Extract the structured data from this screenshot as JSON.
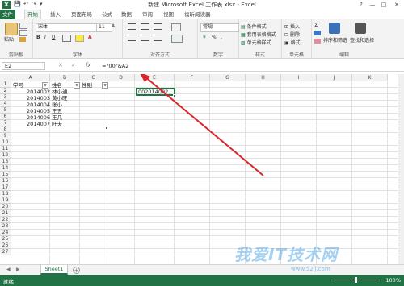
{
  "window": {
    "title": "新建 Microsoft Excel 工作表.xlsx - Excel",
    "app_letter": "X",
    "controls": [
      "?",
      "—",
      "□",
      "✕"
    ]
  },
  "quick_access": [
    "💾",
    "↶",
    "↷",
    "▾"
  ],
  "ribbon_tabs": [
    "文件",
    "开始",
    "插入",
    "页面布局",
    "公式",
    "数据",
    "审阅",
    "视图",
    "福昕阅读器"
  ],
  "ribbon": {
    "clipboard": {
      "label": "剪贴板",
      "paste": "粘贴"
    },
    "font": {
      "label": "字体",
      "name": "宋体",
      "size": "11",
      "bold": "B",
      "italic": "I",
      "underline": "U"
    },
    "alignment": {
      "label": "对齐方式"
    },
    "number": {
      "label": "数字",
      "format": "常规",
      "percent": "%",
      "comma": ","
    },
    "styles": {
      "label": "样式",
      "conditional": "条件格式",
      "table": "套用表格格式",
      "cell": "单元格样式"
    },
    "cells": {
      "label": "单元格",
      "insert": "插入",
      "delete": "删除",
      "format": "格式"
    },
    "editing": {
      "label": "编辑",
      "sort": "排序和筛选",
      "find": "查找和选择"
    }
  },
  "formula_bar": {
    "name_box": "E2",
    "cancel": "✕",
    "confirm": "✓",
    "fx": "fx",
    "formula": "=\"00\"&A2"
  },
  "columns": [
    "A",
    "B",
    "C",
    "D",
    "E",
    "F",
    "G",
    "H",
    "I",
    "J",
    "K"
  ],
  "rows": [
    "1",
    "2",
    "3",
    "4",
    "5",
    "6",
    "7",
    "8",
    "9",
    "10",
    "11",
    "12",
    "13",
    "14",
    "15",
    "16",
    "17",
    "18",
    "19",
    "20",
    "21",
    "22",
    "23",
    "24",
    "25",
    "26",
    "27"
  ],
  "headers_row": {
    "a": "学号",
    "b": "姓名",
    "c": "性别"
  },
  "data_rows": [
    {
      "id": "2014002",
      "name": "林小通"
    },
    {
      "id": "2014003",
      "name": "黄小旺"
    },
    {
      "id": "2014004",
      "name": "张小"
    },
    {
      "id": "2014005",
      "name": "王五"
    },
    {
      "id": "2014006",
      "name": "王几"
    },
    {
      "id": "2014007",
      "name": "旺夫"
    }
  ],
  "selected_cell_value": "002014002",
  "sheet": {
    "tab": "Sheet1",
    "add": "+",
    "nav_prev": "◀",
    "nav_next": "▶"
  },
  "status": {
    "ready": "就绪",
    "zoom": "100%"
  },
  "watermark": {
    "text": "我爱IT技术网",
    "url": "www.52ij.com"
  },
  "colors": {
    "accent": "#217346",
    "arrow": "#d9262c"
  }
}
